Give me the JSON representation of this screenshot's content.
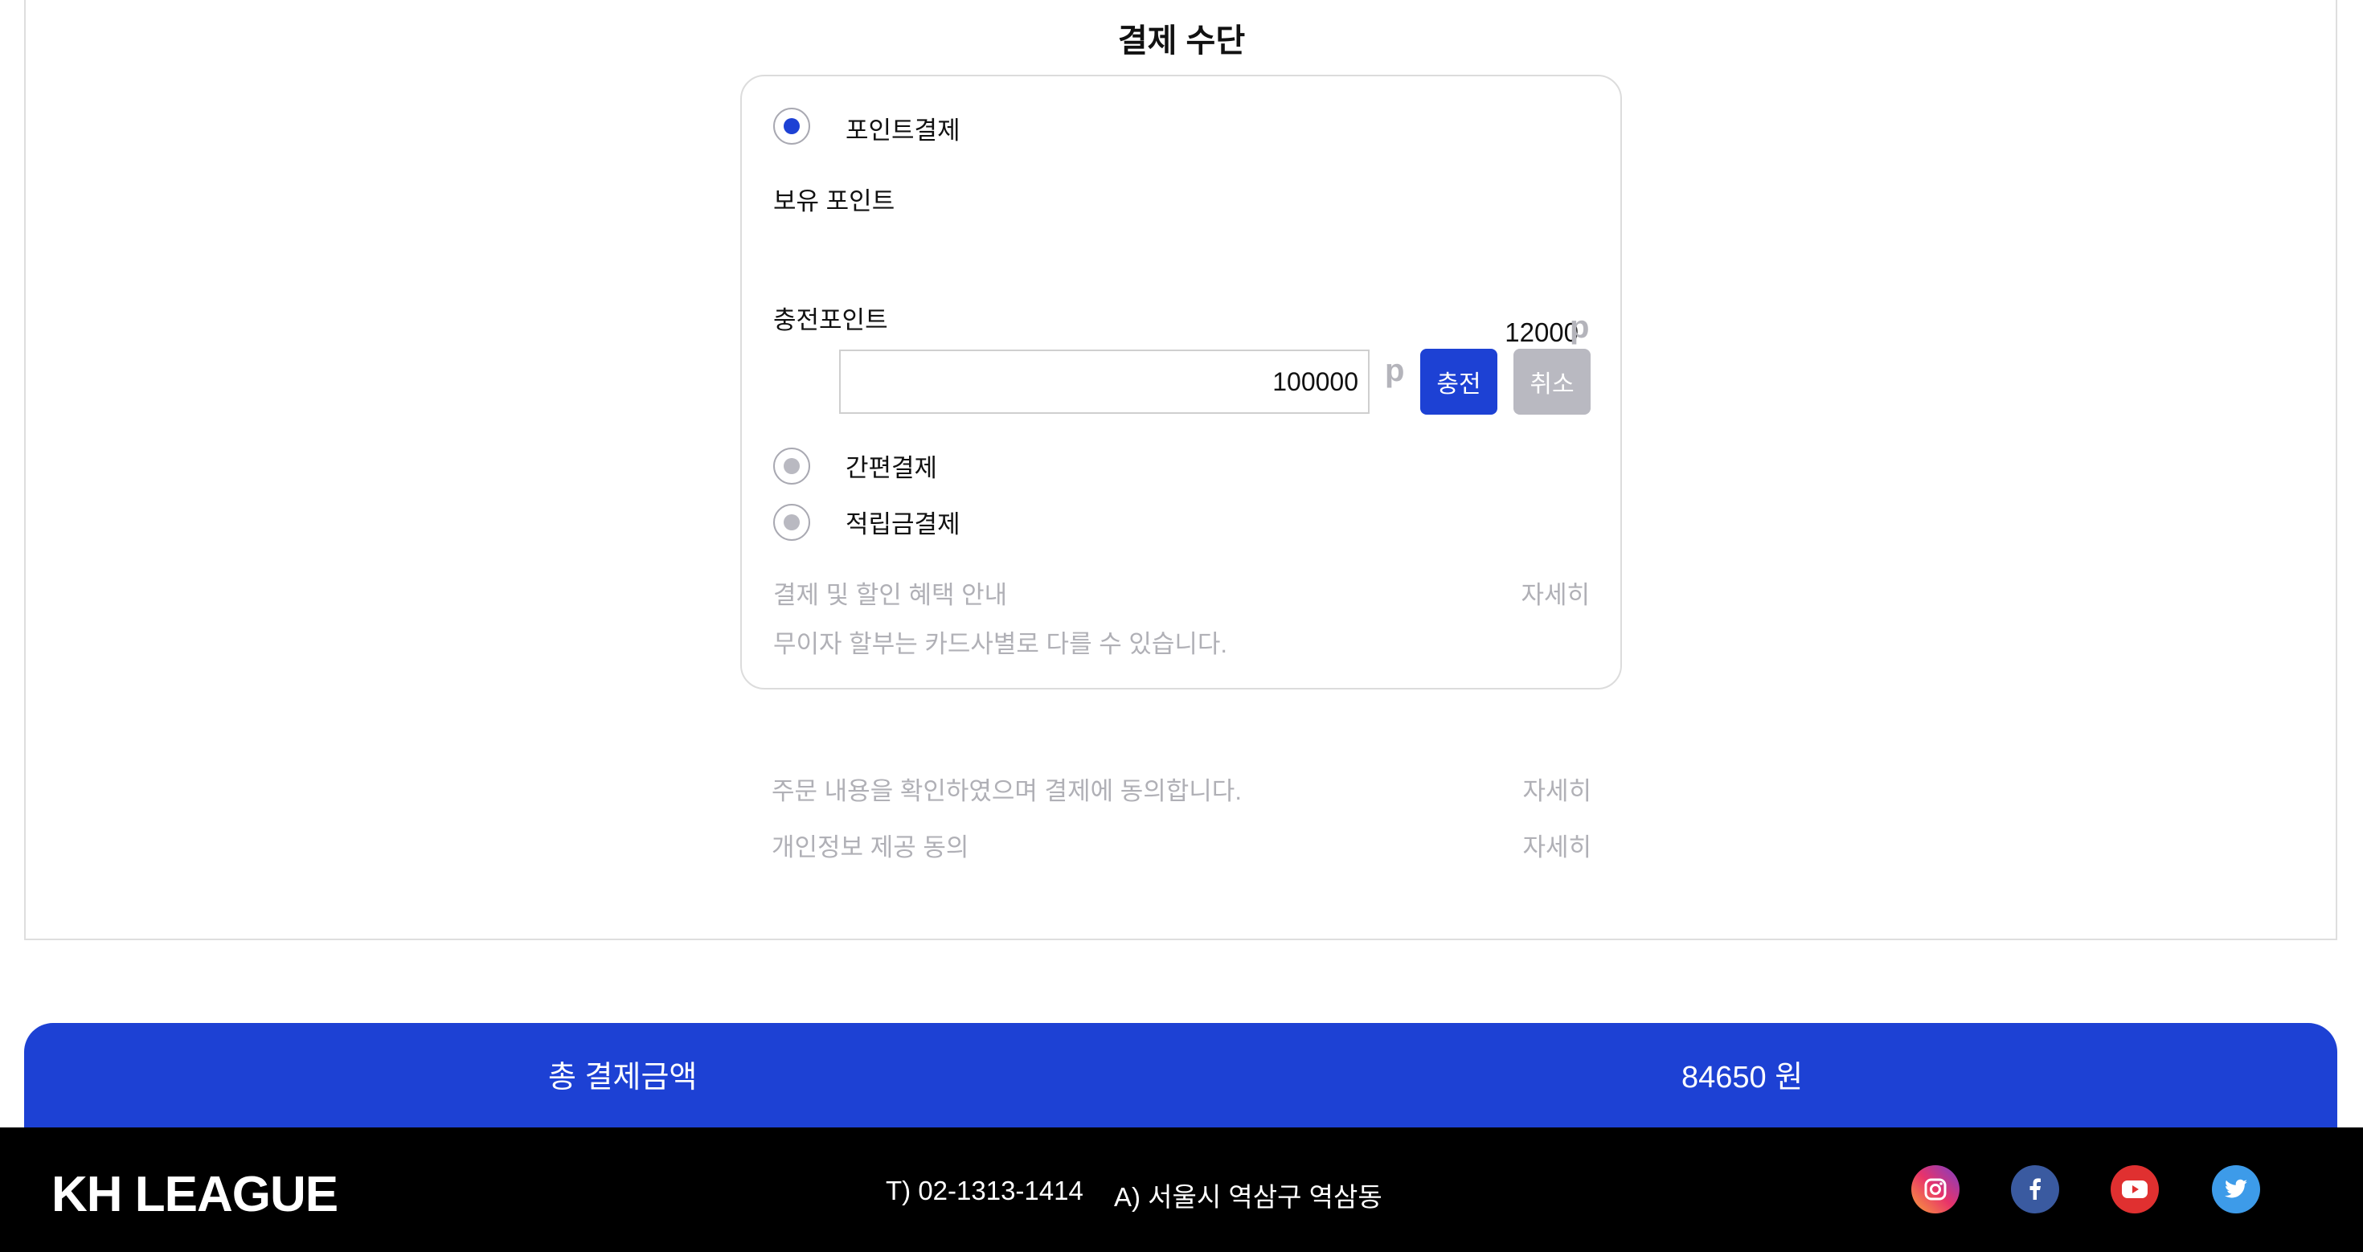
{
  "payment": {
    "section_title": "결제 수단",
    "options": [
      {
        "label": "포인트결제",
        "selected": true
      },
      {
        "label": "간편결제",
        "selected": false
      },
      {
        "label": "적립금결제",
        "selected": false
      }
    ],
    "held_points": {
      "label": "보유 포인트",
      "value": "12000",
      "unit": "p"
    },
    "charge_points": {
      "label": "충전포인트",
      "value": "100000",
      "unit": "p",
      "charge_button": "충전",
      "cancel_button": "취소"
    },
    "benefit": {
      "title": "결제 및 할인 혜택 안내",
      "detail": "자세히",
      "note": "무이자 할부는 카드사별로 다를 수 있습니다."
    }
  },
  "agreements": [
    {
      "text": "주문 내용을 확인하였으며 결제에 동의합니다.",
      "detail": "자세히"
    },
    {
      "text": "개인정보 제공 동의",
      "detail": "자세히"
    }
  ],
  "total": {
    "label": "총 결제금액",
    "value": "84650 원"
  },
  "footer": {
    "brand": "KH LEAGUE",
    "phone": "T) 02-1313-1414",
    "address": "A) 서울시 역삼구 역삼동",
    "social_icons": [
      "instagram-icon",
      "facebook-icon",
      "youtube-icon",
      "twitter-icon"
    ]
  },
  "colors": {
    "accent": "#1d41d4",
    "muted": "#b0b0b6",
    "footer_bg": "#000000"
  }
}
